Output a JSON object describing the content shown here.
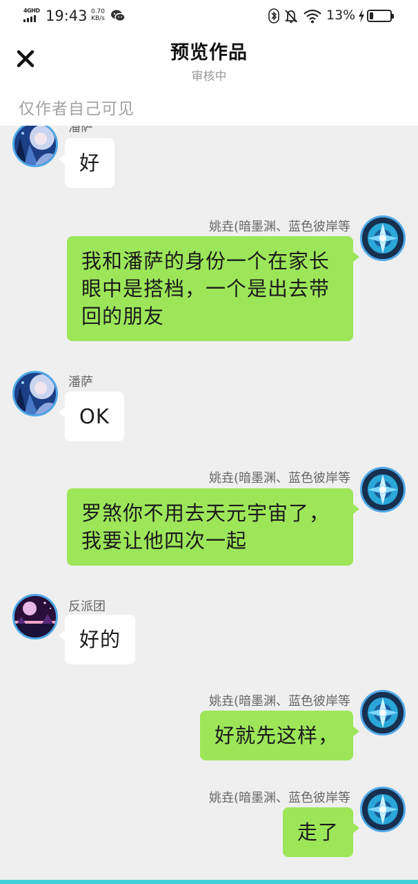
{
  "status_bar": {
    "network": "4GHD",
    "time": "19:43",
    "speed_value": "0.70",
    "speed_unit": "KB/s",
    "battery_percent": "13%",
    "icons": [
      "signal-icon",
      "wechat-icon",
      "bluetooth-icon",
      "mute-icon",
      "wifi-icon",
      "charging-icon",
      "battery-icon"
    ]
  },
  "header": {
    "title": "预览作品",
    "subtitle": "审核中",
    "visibility": "仅作者自己可见",
    "close_icon": "close-icon"
  },
  "messages": [
    {
      "side": "left",
      "name": "潘萨",
      "text": "好",
      "avatar": "anime-avatar-blue"
    },
    {
      "side": "right",
      "name": "姚垚(暗墨渊、蓝色彼岸等",
      "text": "我和潘萨的身份一个在家长眼中是搭档，一个是出去带回的朋友",
      "avatar": "anime-avatar-cyan"
    },
    {
      "side": "left",
      "name": "潘萨",
      "text": "OK",
      "avatar": "anime-avatar-blue"
    },
    {
      "side": "right",
      "name": "姚垚(暗墨渊、蓝色彼岸等",
      "text": "罗煞你不用去天元宇宙了，我要让他四次一起",
      "avatar": "anime-avatar-cyan"
    },
    {
      "side": "left",
      "name": "反派团",
      "text": "好的",
      "avatar": "night-scene-avatar"
    },
    {
      "side": "right",
      "name": "姚垚(暗墨渊、蓝色彼岸等",
      "text": "好就先这样，",
      "avatar": "anime-avatar-cyan"
    },
    {
      "side": "right",
      "name": "姚垚(暗墨渊、蓝色彼岸等",
      "text": "走了",
      "avatar": "anime-avatar-cyan"
    }
  ],
  "colors": {
    "bubble_self": "#9de65a",
    "bubble_other": "#ffffff",
    "avatar_ring": "#4fa8e8",
    "chat_background": "#efefef",
    "bottom_accent": "#3fcfd8"
  }
}
